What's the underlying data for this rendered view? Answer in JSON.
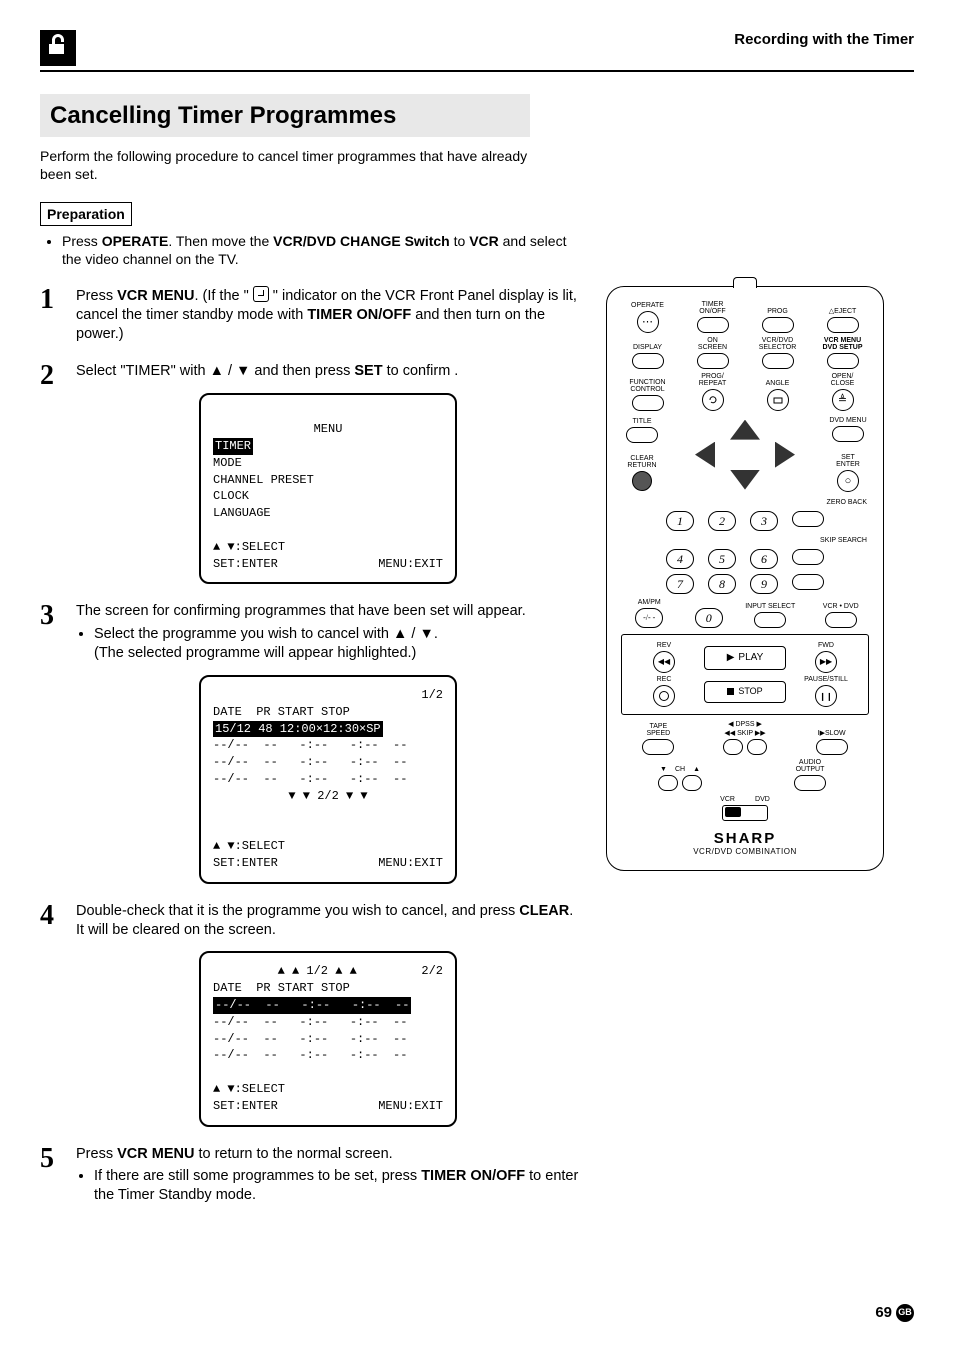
{
  "header": {
    "section": "Recording with the Timer"
  },
  "title": "Cancelling Timer Programmes",
  "intro": "Perform the following procedure to cancel timer programmes that have already been set.",
  "prep": {
    "label": "Preparation",
    "bullets_a": "Press ",
    "operate": "OPERATE",
    "bullets_b": ". Then move the ",
    "switch": "VCR/DVD CHANGE Switch",
    "bullets_c": " to ",
    "vcr": "VCR",
    "bullets_d": " and select the video channel on the TV."
  },
  "steps": {
    "s1": {
      "a": "Press ",
      "b": "VCR MENU",
      "c": ". (If the \" ",
      "d": " \" indicator on the VCR Front Panel display is lit, cancel the timer standby mode with ",
      "e": "TIMER ON/OFF",
      "f": " and then turn on the power.)"
    },
    "s2": {
      "a": "Select \"TIMER\" with ",
      "b": " / ",
      "c": " and then press ",
      "d": "SET",
      "e": " to confirm ."
    },
    "s3": {
      "a": "The screen for confirming programmes that have been set will appear.",
      "b": "Select the programme you wish to cancel with ",
      "c": " / ",
      "d": ".",
      "e": "(The selected programme will appear highlighted.)"
    },
    "s4": {
      "a": "Double-check that it is the programme you wish to cancel, and press ",
      "b": "CLEAR",
      "c": ". It will be cleared on the screen."
    },
    "s5": {
      "a": "Press ",
      "b": "VCR MENU",
      "c": " to return to the normal screen.",
      "d": "If there are still some programmes to be set, press ",
      "e": "TIMER ON/OFF",
      "f": " to enter the Timer Standby mode."
    }
  },
  "osd1": {
    "title": "MENU",
    "items": [
      "TIMER",
      "MODE",
      "CHANNEL PRESET",
      "CLOCK",
      "LANGUAGE"
    ],
    "hint1_pre": "▲ ▼:",
    "hint1": "SELECT",
    "hint2a": "SET:ENTER",
    "hint2b": "MENU:EXIT"
  },
  "osd2": {
    "page": "1/2",
    "header": "DATE  PR START STOP",
    "row_hl": "15/12 48 12:00×12:30×SP",
    "row_blank": "--/--  --   -:--   -:--  --",
    "nav": "▼ ▼ 2/2 ▼ ▼",
    "hint1": "▲ ▼:SELECT",
    "hint2a": "SET:ENTER",
    "hint2b": "MENU:EXIT"
  },
  "osd3": {
    "nav": "▲ ▲ 1/2 ▲ ▲",
    "page": "2/2",
    "header": "DATE  PR START STOP",
    "row_hl": "--/--  --   -:--   -:--  --",
    "row_blank": "--/--  --   -:--   -:--  --",
    "hint1": "▲ ▼:SELECT",
    "hint2a": "SET:ENTER",
    "hint2b": "MENU:EXIT"
  },
  "remote": {
    "row1": {
      "operate": "OPERATE",
      "timer": "TIMER\nON/OFF",
      "prog": "PROG",
      "eject": "△EJECT"
    },
    "row2": {
      "display": "DISPLAY",
      "on": "ON\nSCREEN",
      "sel": "VCR/DVD\nSELECTOR",
      "menu": "VCR MENU\nDVD SETUP"
    },
    "row3": {
      "fc": "FUNCTION\nCONTROL",
      "pr": "PROG/\nREPEAT",
      "angle": "ANGLE",
      "open": "OPEN/\nCLOSE"
    },
    "row4": {
      "title": "TITLE",
      "dvdmenu": "DVD MENU"
    },
    "dpad": {
      "clear": "CLEAR\nRETURN",
      "set": "SET\nENTER"
    },
    "nums": [
      "1",
      "2",
      "3",
      "4",
      "5",
      "6",
      "7",
      "8",
      "9",
      "0"
    ],
    "side": {
      "zero": "ZERO BACK",
      "skip": "SKIP SEARCH",
      "ampm": "AM/PM",
      "minus": "-/- -",
      "input": "INPUT SELECT",
      "vcrdvd": "VCR • DVD"
    },
    "transport": {
      "rev": "REV",
      "fwd": "FWD",
      "play": "PLAY",
      "rec": "REC",
      "pause": "PAUSE/STILL",
      "stop": "STOP"
    },
    "lower": {
      "tape": "TAPE\nSPEED",
      "dpss": "◀ DPSS ▶",
      "skip": "◀◀ SKIP ▶▶",
      "slow": "I▶SLOW",
      "ch": "CH",
      "audio": "AUDIO\nOUTPUT",
      "vcr": "VCR",
      "dvd": "DVD"
    },
    "brand": "SHARP",
    "brand_sub": "VCR/DVD COMBINATION"
  },
  "footer": {
    "page": "69",
    "region": "GB"
  }
}
